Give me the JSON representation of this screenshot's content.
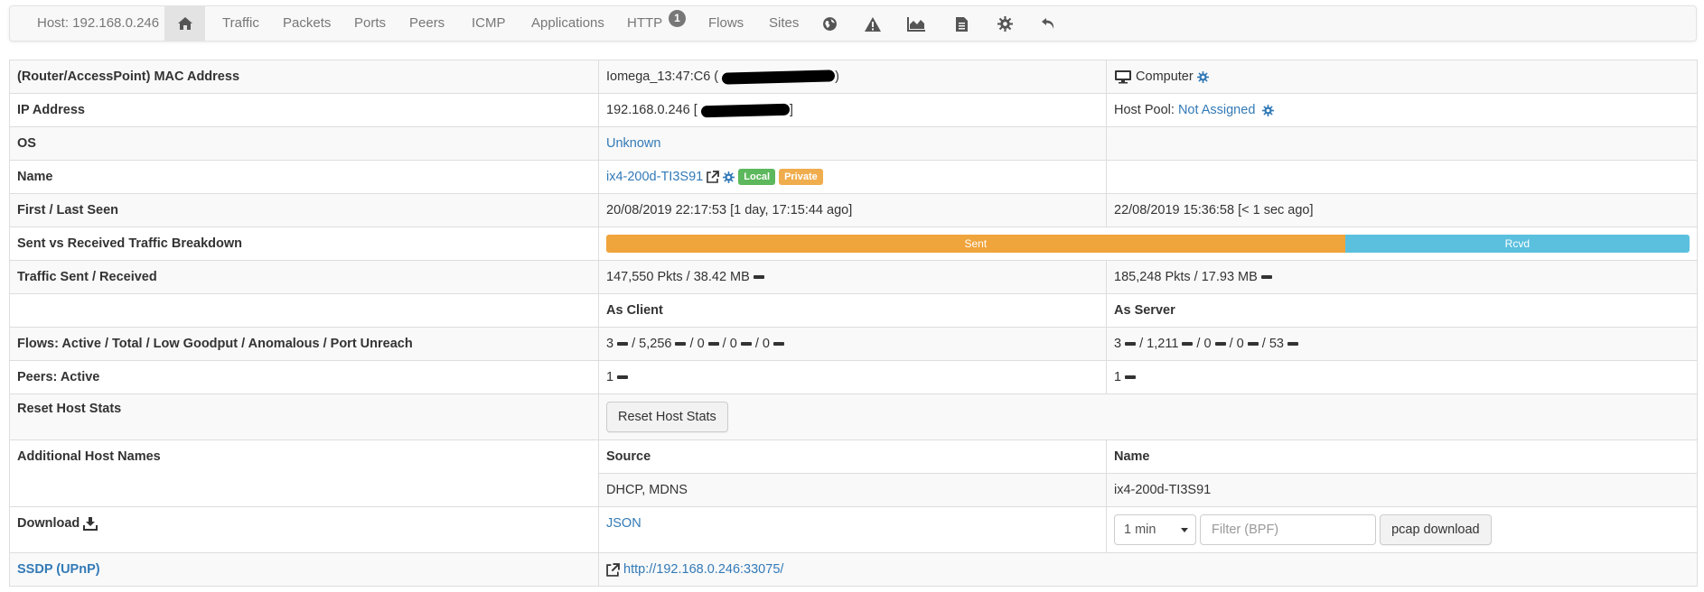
{
  "nav": {
    "host": "Host: 192.168.0.246",
    "tabs": [
      "Traffic",
      "Packets",
      "Ports",
      "Peers",
      "ICMP",
      "Applications",
      "HTTP",
      "Flows",
      "Sites"
    ],
    "http_badge": "1",
    "icons": [
      "home-icon",
      "globe-icon",
      "warning-icon",
      "area-chart-icon",
      "file-icon",
      "gear-icon",
      "undo-icon"
    ]
  },
  "rows": {
    "mac": {
      "label": "(Router/AccessPoint) MAC Address",
      "value": "Iomega_13:47:C6 (",
      "value_end": ")",
      "device": "Computer"
    },
    "ip": {
      "label": "IP Address",
      "value": "192.168.0.246 [",
      "value_end": "]",
      "pool_label": "Host Pool:",
      "pool_value": "Not Assigned"
    },
    "os": {
      "label": "OS",
      "value": "Unknown"
    },
    "name": {
      "label": "Name",
      "value": "ix4-200d-TI3S91",
      "badge_local": "Local",
      "badge_private": "Private"
    },
    "seen": {
      "label": "First / Last Seen",
      "first": "20/08/2019 22:17:53 [1 day, 17:15:44 ago]",
      "last": "22/08/2019 15:36:58 [< 1 sec ago]"
    },
    "breakdown": {
      "label": "Sent vs Received Traffic Breakdown",
      "sent_label": "Sent",
      "rcvd_label": "Rcvd",
      "sent_fraction": 0.682,
      "sent_color": "#f0a43c",
      "rcvd_color": "#5bc0de"
    },
    "traffic": {
      "label": "Traffic Sent / Received",
      "sent": "147,550 Pkts / 38.42 MB",
      "received": "185,248 Pkts / 17.93 MB"
    },
    "roles": {
      "client": "As Client",
      "server": "As Server"
    },
    "flows": {
      "label": "Flows: Active / Total / Low Goodput / Anomalous / Port Unreach",
      "client": [
        "3",
        "5,256",
        "0",
        "0",
        "0"
      ],
      "server": [
        "3",
        "1,211",
        "0",
        "0",
        "53"
      ]
    },
    "peers": {
      "label": "Peers: Active",
      "client": "1",
      "server": "1"
    },
    "reset": {
      "label": "Reset Host Stats",
      "button": "Reset Host Stats"
    },
    "additional": {
      "label": "Additional Host Names",
      "col_source": "Source",
      "col_name": "Name",
      "source": "DHCP, MDNS",
      "name": "ix4-200d-TI3S91"
    },
    "download": {
      "label": "Download",
      "json": "JSON",
      "interval": "1 min",
      "filter_placeholder": "Filter (BPF)",
      "pcap_button": "pcap download"
    },
    "ssdp": {
      "label": "SSDP (UPnP)",
      "url": "http://192.168.0.246:33075/"
    }
  }
}
